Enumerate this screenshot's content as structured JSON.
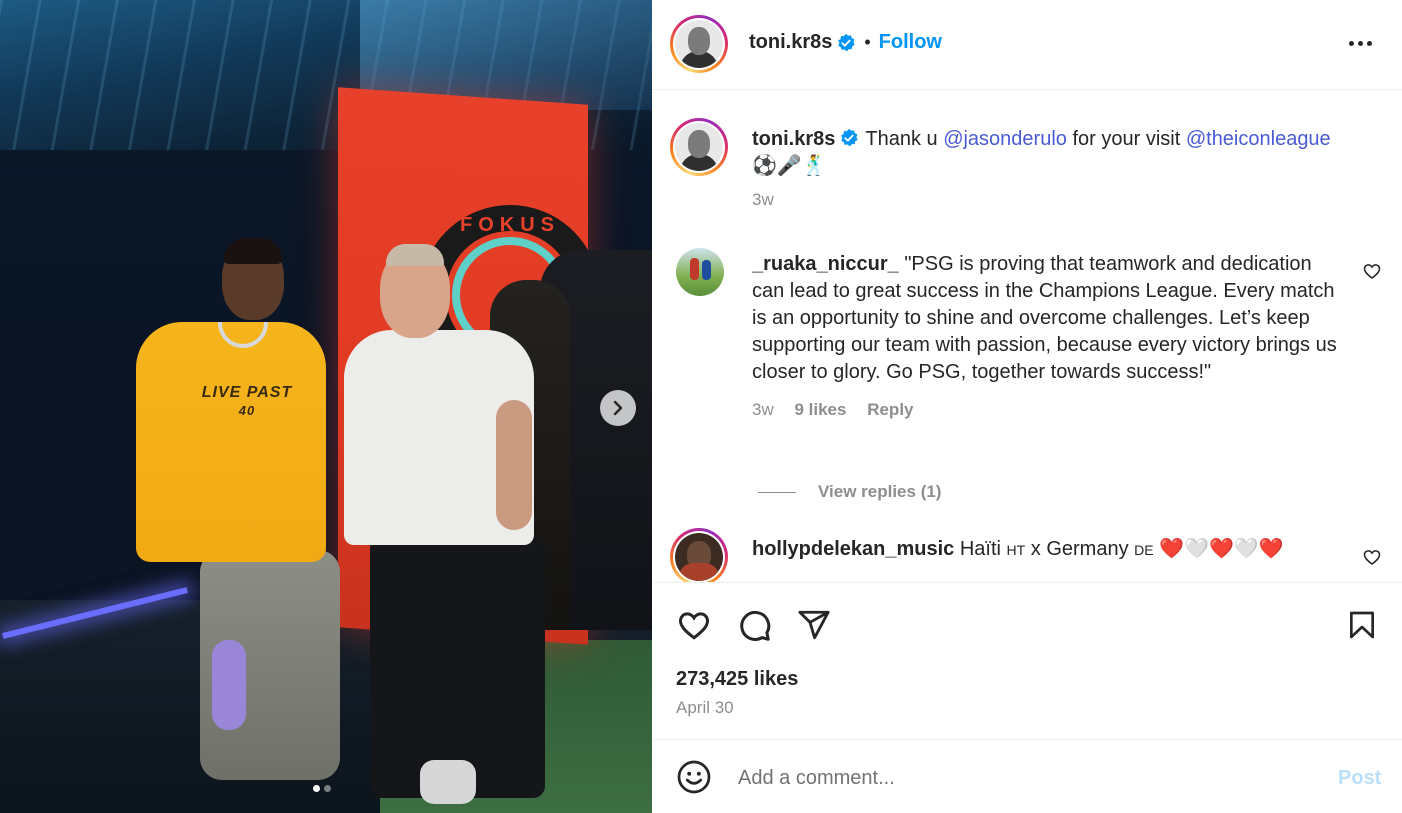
{
  "post": {
    "username": "toni.kr8s",
    "separator": "•",
    "follow_label": "Follow",
    "caption": {
      "username": "toni.kr8s",
      "text_before": "Thank u ",
      "mention1": "@jasonderulo",
      "text_middle": " for your visit ",
      "mention2": "@theiconleague",
      "emojis": "⚽🎤🕺",
      "time": "3w"
    }
  },
  "image": {
    "sign_text": "FOKUS",
    "shirt_text": "LIVE PAST",
    "shirt_number": "40"
  },
  "comments": [
    {
      "username": "_ruaka_niccur_",
      "text": "\"PSG is proving that teamwork and dedication can lead to great success in the Champions League. Every match is an opportunity to shine and overcome challenges. Let’s keep supporting our team with passion, because every victory brings us closer to glory. Go PSG, together towards success!\"",
      "time": "3w",
      "likes": "9 likes",
      "reply_label": "Reply",
      "view_replies": "View replies (1)"
    },
    {
      "username": "hollypdelekan_music",
      "text": "Haïti ",
      "flag1": "HT",
      "mid": " x Germany ",
      "flag2": "DE",
      "hearts": "❤️🤍❤️🤍❤️"
    }
  ],
  "actions": {
    "likes": "273,425 likes",
    "date": "April 30"
  },
  "add_comment": {
    "placeholder": "Add a comment...",
    "post_label": "Post"
  },
  "icons": [
    "verified-badge-icon",
    "more-options-icon",
    "heart-icon",
    "comment-icon",
    "share-icon",
    "bookmark-icon",
    "emoji-icon",
    "next-arrow-icon"
  ],
  "colors": {
    "link": "#0095f6",
    "mention": "#4a5bd4",
    "heart_red": "#ed1c24",
    "post_disabled": "#b9dffc"
  }
}
